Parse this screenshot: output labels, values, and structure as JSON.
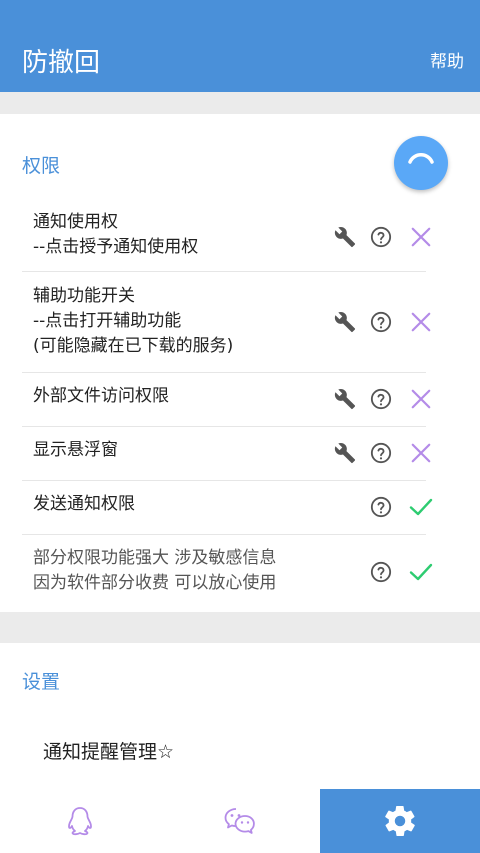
{
  "appbar": {
    "title": "防撤回",
    "help_label": "帮助"
  },
  "permissions": {
    "section_title": "权限",
    "rows": [
      {
        "lines": [
          "通知使用权",
          "--点击授予通知使用权"
        ],
        "wrench": true,
        "status": "denied"
      },
      {
        "lines": [
          "辅助功能开关",
          "--点击打开辅助功能",
          "(可能隐藏在已下载的服务)"
        ],
        "wrench": true,
        "status": "denied"
      },
      {
        "lines": [
          "外部文件访问权限"
        ],
        "wrench": true,
        "status": "denied"
      },
      {
        "lines": [
          "显示悬浮窗"
        ],
        "wrench": true,
        "status": "denied"
      },
      {
        "lines": [
          "发送通知权限"
        ],
        "wrench": false,
        "status": "granted"
      },
      {
        "lines": [
          "部分权限功能强大 涉及敏感信息",
          "因为软件部分收费 可以放心使用"
        ],
        "wrench": false,
        "status": "granted"
      }
    ]
  },
  "settings": {
    "section_title": "设置",
    "notify_manage_label": "通知提醒管理☆"
  },
  "bottom_nav": {
    "items": [
      {
        "icon": "qq-penguin-icon"
      },
      {
        "icon": "wechat-icon"
      },
      {
        "icon": "gear-icon",
        "active": true
      }
    ]
  },
  "colors": {
    "accent": "#4a90d9",
    "fab": "#5aa8f7",
    "denied": "#b48be8",
    "granted": "#2ecc71",
    "icon_gray": "#555555"
  }
}
